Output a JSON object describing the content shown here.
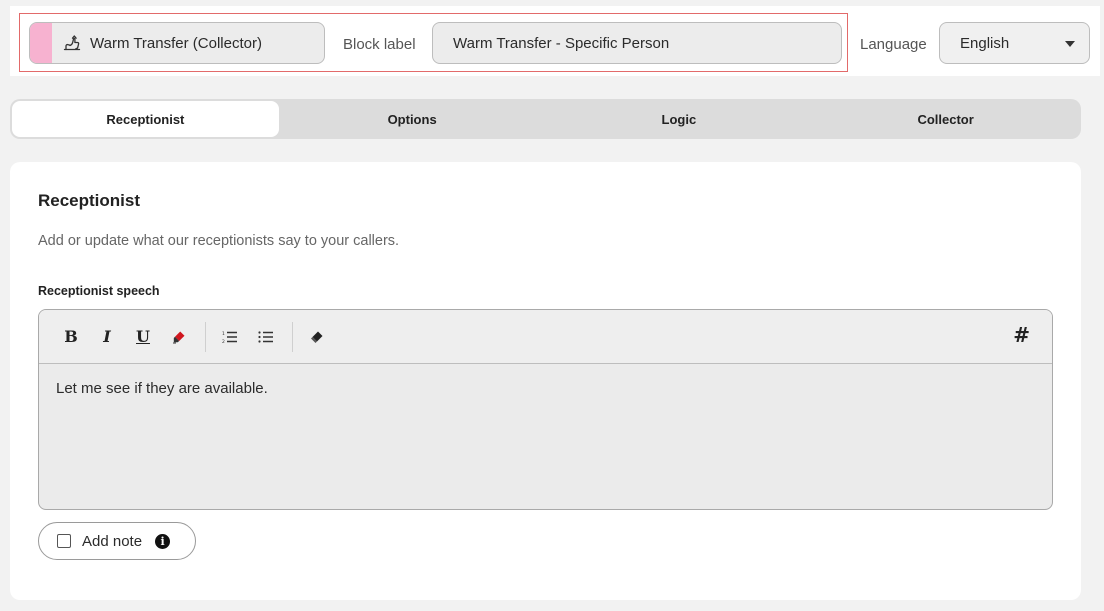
{
  "header": {
    "block_type": "Warm Transfer (Collector)",
    "block_type_icon": "hand-transfer-icon",
    "block_type_color": "#f7b2d0",
    "block_label_text": "Block label",
    "block_label_value": "Warm Transfer - Specific Person",
    "language_label": "Language",
    "language_value": "English",
    "highlight_color": "#e26a6a"
  },
  "tabs": [
    {
      "label": "Receptionist",
      "active": true
    },
    {
      "label": "Options",
      "active": false
    },
    {
      "label": "Logic",
      "active": false
    },
    {
      "label": "Collector",
      "active": false
    }
  ],
  "main": {
    "title": "Receptionist",
    "description": "Add or update what our receptionists say to your callers.",
    "speech_label": "Receptionist speech",
    "toolbar": {
      "bold": "B",
      "italic": "I",
      "underline": "U",
      "hash": "#"
    },
    "speech_text": "Let me see if they are available.",
    "add_note_label": "Add note",
    "add_note_checked": false
  }
}
